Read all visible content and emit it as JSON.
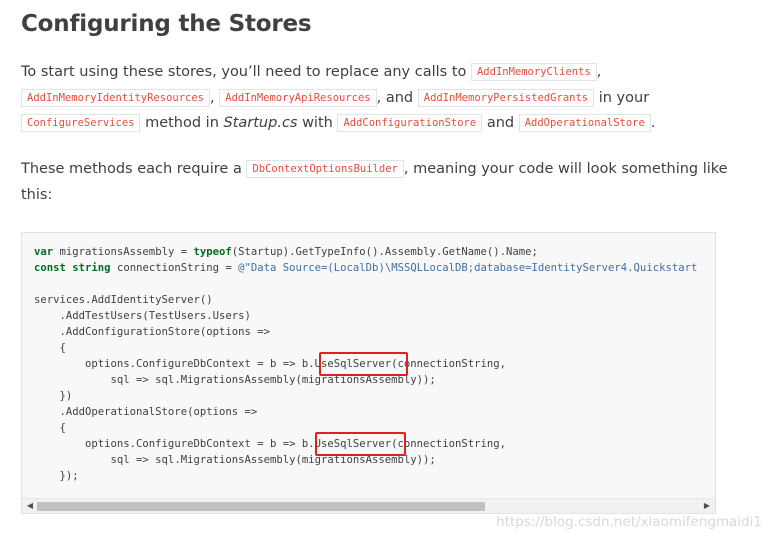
{
  "heading": "Configuring the Stores",
  "para1": {
    "l1_t1": "To start using these stores, you’ll need to replace any calls to ",
    "c1": "AddInMemoryClients",
    "l1_t2": ",",
    "c2": "AddInMemoryIdentityResources",
    "l2_t1": ",",
    "c3": "AddInMemoryApiResources",
    "l2_t2": ", and",
    "c4": "AddInMemoryPersistedGrants",
    "l2_t3": " in your",
    "c5": "ConfigureServices",
    "l3_t1": " method in ",
    "em1": "Startup.cs",
    "l3_t2": " with ",
    "c6": "AddConfigurationStore",
    "l3_t3": " and",
    "c7": "AddOperationalStore",
    "l3_t4": "."
  },
  "para2": {
    "t1": "These methods each require a ",
    "c1": "DbContextOptionsBuilder",
    "t2": ", meaning your code will look something like",
    "t3": "this:"
  },
  "code": {
    "l1_kw1": "var",
    "l1_a": " migrationsAssembly = ",
    "l1_kw2": "typeof",
    "l1_b": "(Startup).GetTypeInfo().Assembly.GetName().Name;",
    "l2_kw1": "const",
    "l2_a": " ",
    "l2_kw2": "string",
    "l2_b": " connectionString = ",
    "l2_str": "@\"Data Source=(LocalDb)\\MSSQLLocalDB;database=IdentityServer4.Quickstart",
    "l4": "services.AddIdentityServer()",
    "l5": "    .AddTestUsers(TestUsers.Users)",
    "l6": "    .AddConfigurationStore(options =>",
    "l7": "    {",
    "l8": "        options.ConfigureDbContext = b => b.UseSqlServer(connectionString,",
    "l9": "            sql => sql.MigrationsAssembly(migrationsAssembly));",
    "l10": "    })",
    "l11": "    .AddOperationalStore(options =>",
    "l12": "    {",
    "l13": "        options.ConfigureDbContext = b => b.UseSqlServer(connectionString,",
    "l14": "            sql => sql.MigrationsAssembly(migrationsAssembly));",
    "l15": "    });"
  },
  "scrollbar": {
    "left_arrow": "◀",
    "right_arrow": "▶",
    "position": 0.0,
    "visible_fraction": 0.67
  },
  "watermark": "https://blog.csdn.net/xiaomifengmaidi1",
  "colors": {
    "text": "#404040",
    "inline_code": "#e74c3c",
    "keyword": "#007020",
    "string": "#4070a0",
    "highlight_box": "#e02020",
    "code_bg": "#f8f8f8"
  }
}
